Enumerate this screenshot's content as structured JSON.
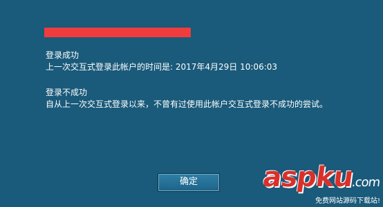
{
  "success": {
    "title": "登录成功",
    "detail": "上一次交互式登录此帐户的时间是: 2017年4月29日 10:06:03"
  },
  "failure": {
    "title": "登录不成功",
    "detail": "自从上一次交互式登录以来，不曾有过使用此帐户交互式登录不成功的尝试。"
  },
  "button": {
    "ok_label": "确定"
  },
  "watermark": {
    "logo": "aspku",
    "suffix": ".com",
    "slogan": "免费网站源码下载站!"
  },
  "colors": {
    "background": "#1a5a7a",
    "redaction": "#f03c3c",
    "watermark_logo": "#d9302b"
  }
}
